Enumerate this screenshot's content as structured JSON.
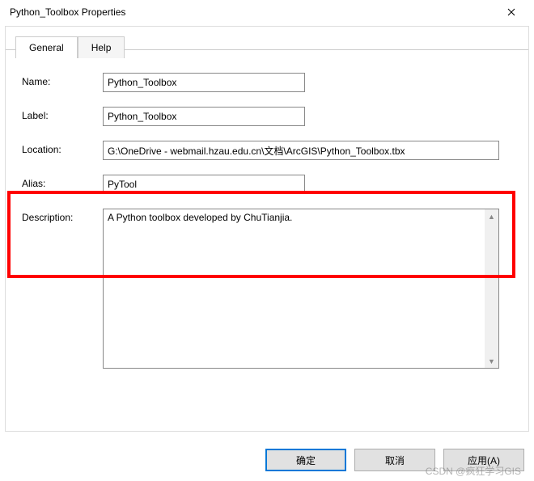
{
  "titlebar": {
    "title": "Python_Toolbox Properties"
  },
  "tabs": {
    "general": "General",
    "help": "Help"
  },
  "labels": {
    "name": "Name:",
    "label": "Label:",
    "location": "Location:",
    "alias": "Alias:",
    "description": "Description:"
  },
  "values": {
    "name": "Python_Toolbox",
    "label": "Python_Toolbox",
    "location": "G:\\OneDrive - webmail.hzau.edu.cn\\文档\\ArcGIS\\Python_Toolbox.tbx",
    "alias": "PyTool",
    "description": "A Python toolbox developed by ChuTianjia."
  },
  "buttons": {
    "ok": "确定",
    "cancel": "取消",
    "apply": "应用(A)"
  },
  "watermark": "CSDN @疯狂学习GIS"
}
